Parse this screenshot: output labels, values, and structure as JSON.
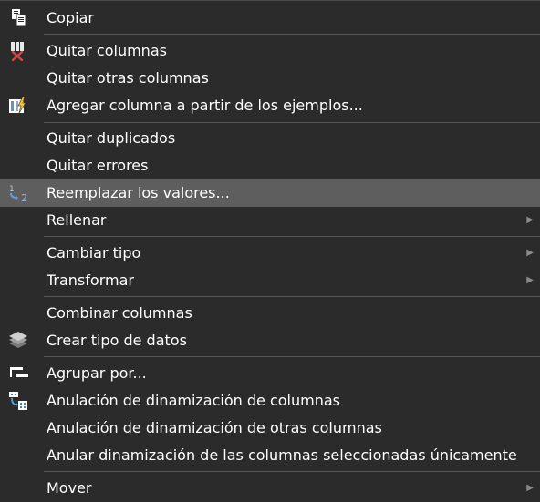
{
  "menu": {
    "items": [
      {
        "label": "Copiar",
        "icon": "copy-icon"
      },
      {
        "label": "Quitar columnas",
        "icon": "remove-columns-icon"
      },
      {
        "label": "Quitar otras columnas"
      },
      {
        "label": "Agregar columna a partir de los ejemplos...",
        "icon": "column-from-examples-icon"
      },
      {
        "label": "Quitar duplicados"
      },
      {
        "label": "Quitar errores"
      },
      {
        "label": "Reemplazar los valores...",
        "icon": "replace-values-icon",
        "highlighted": true
      },
      {
        "label": "Rellenar",
        "submenu": true
      },
      {
        "label": "Cambiar tipo",
        "submenu": true
      },
      {
        "label": "Transformar",
        "submenu": true
      },
      {
        "label": "Combinar columnas"
      },
      {
        "label": "Crear tipo de datos",
        "icon": "create-data-type-icon"
      },
      {
        "label": "Agrupar por...",
        "icon": "group-by-icon"
      },
      {
        "label": "Anulación de dinamización de columnas",
        "icon": "unpivot-columns-icon"
      },
      {
        "label": "Anulación de dinamización de otras columnas"
      },
      {
        "label": "Anular dinamización de las columnas seleccionadas únicamente"
      },
      {
        "label": "Mover",
        "submenu": true
      }
    ]
  }
}
